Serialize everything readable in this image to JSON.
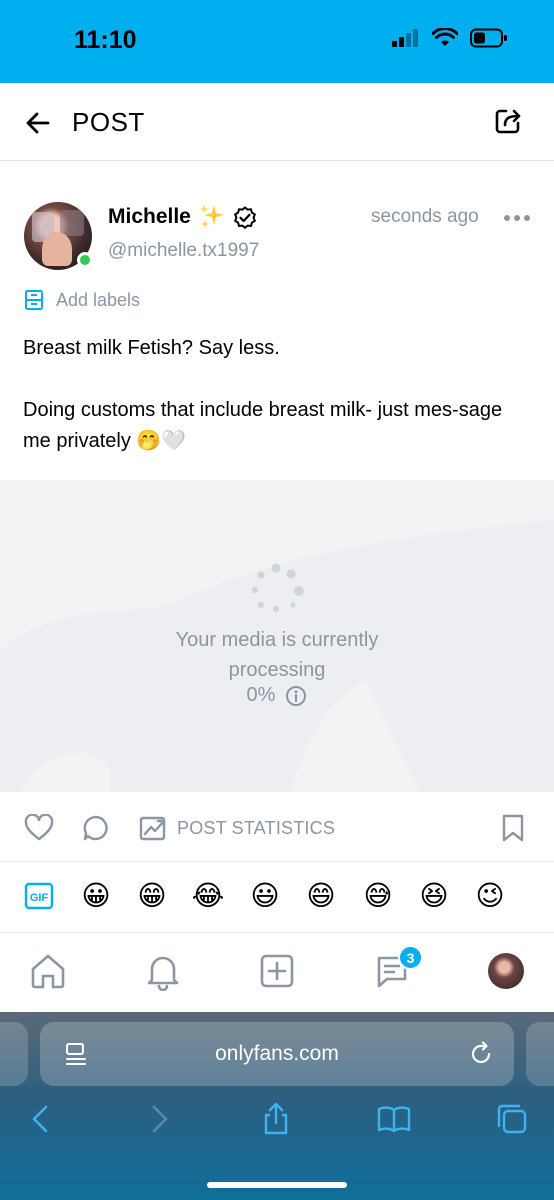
{
  "status_bar": {
    "time": "11:10",
    "bg_color": "#00aff0",
    "icons": [
      "signal-icon",
      "wifi-icon",
      "battery-icon"
    ]
  },
  "header": {
    "title": "POST",
    "back_icon": "arrow-left-icon",
    "share_icon": "share-icon"
  },
  "post": {
    "author_name": "Michelle",
    "author_handle": "@michelle.tx1997",
    "timestamp": "seconds ago",
    "verified": true,
    "online": true,
    "add_labels": "Add labels",
    "text_line1": "Breast milk Fetish? Say less.",
    "text_line2": "Doing customs that include breast milk- just mes-sage me privately 🤭🤍"
  },
  "media": {
    "status_text": "Your media is currently processing",
    "progress_label": "0%",
    "progress": 0
  },
  "actions": {
    "post_statistics": "POST STATISTICS"
  },
  "emoji_bar": {
    "gif_label": "GIF",
    "emojis": [
      "😀",
      "😁",
      "😂",
      "😃",
      "😄",
      "😅",
      "😆",
      "😉"
    ]
  },
  "bottom_nav": {
    "items": [
      "home-icon",
      "bell-icon",
      "add-post-icon",
      "messages-icon",
      "profile-avatar"
    ],
    "messages_badge": "3"
  },
  "browser": {
    "url": "onlyfans.com",
    "toolbar": [
      "back-icon",
      "forward-icon",
      "share-icon",
      "bookmarks-icon",
      "tabs-icon"
    ]
  },
  "colors": {
    "accent": "#00aff0",
    "muted_text": "#8a96a3",
    "online": "#34c759"
  }
}
